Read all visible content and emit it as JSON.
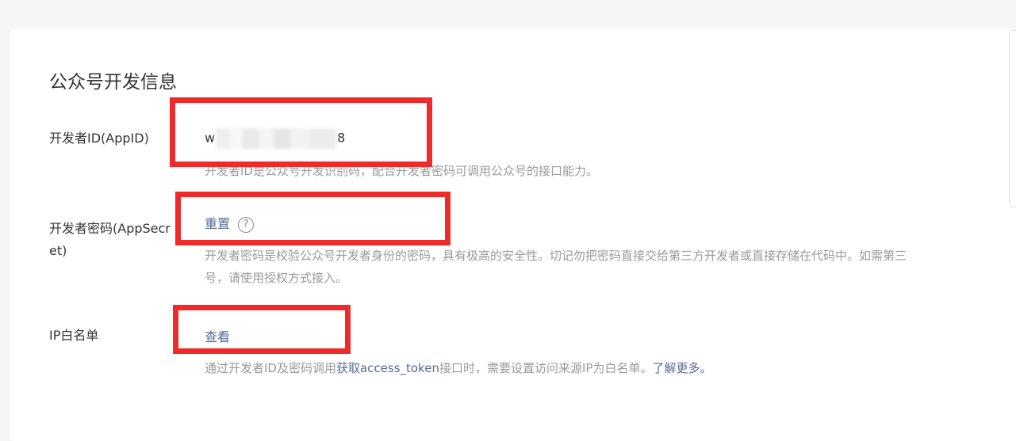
{
  "section_title": "公众号开发信息",
  "appid": {
    "label": "开发者ID(AppID)",
    "value_prefix": "w",
    "value_suffix": "8",
    "desc": "开发者ID是公众号开发识别码，配合开发者密码可调用公众号的接口能力。"
  },
  "appsecret": {
    "label": "开发者密码(AppSecret)",
    "action": "重置",
    "help": "?",
    "desc_line1": "开发者密码是校验公众号开发者身份的密码，具有极高的安全性。切记勿把密码直接交给第三方开发者或直接存储在代码中。如需第三",
    "desc_line2": "号，请使用授权方式接入。"
  },
  "ip_whitelist": {
    "label": "IP白名单",
    "action": "查看",
    "desc_pre": "通过开发者ID及密码调用",
    "desc_link1": "获取access_token",
    "desc_mid": "接口时，需要设置访问来源IP为白名单。",
    "desc_link2": "了解更多。"
  },
  "colors": {
    "link": "#576b95",
    "annotation_red": "#ee2a2a",
    "desc_text": "#9a9a9a"
  }
}
